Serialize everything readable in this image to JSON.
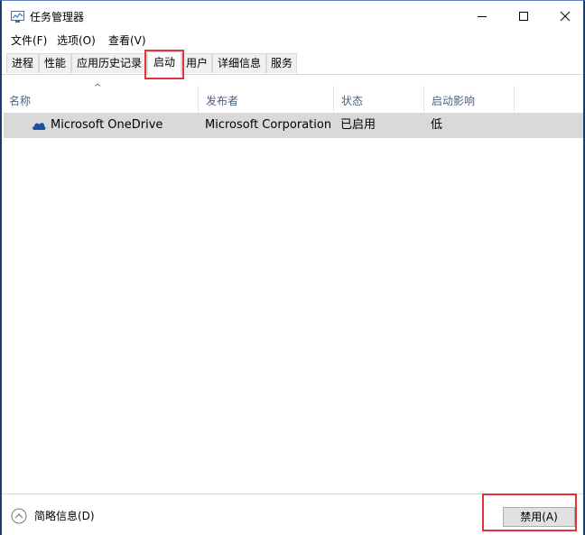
{
  "window": {
    "title": "任务管理器"
  },
  "menu": [
    "文件(F)",
    "选项(O)",
    "查看(V)"
  ],
  "tabs": [
    "进程",
    "性能",
    "应用历史记录",
    "启动",
    "用户",
    "详细信息",
    "服务"
  ],
  "active_tab": "启动",
  "columns": [
    "名称",
    "发布者",
    "状态",
    "启动影响"
  ],
  "rows": [
    {
      "name": "Microsoft OneDrive",
      "publisher": "Microsoft Corporation",
      "status": "已启用",
      "impact": "低",
      "icon": "onedrive-cloud-icon"
    }
  ],
  "footer": {
    "fewer_details": "简略信息(D)",
    "disable_button": "禁用(A)"
  },
  "colors": {
    "highlight": "#e0343a",
    "window_border": "#1b3a6e",
    "selected_row": "#d9d9d9",
    "header_text": "#4d6082"
  }
}
